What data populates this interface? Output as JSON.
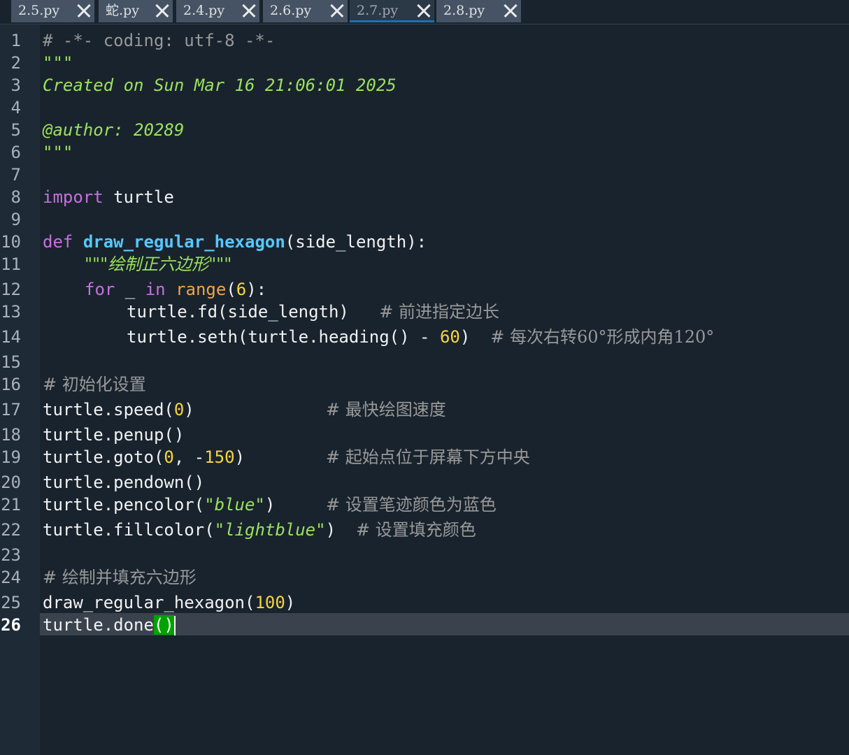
{
  "tabs": [
    {
      "label": "2.5.py",
      "active": false
    },
    {
      "label": "蛇.py",
      "active": false
    },
    {
      "label": "2.4.py",
      "active": false
    },
    {
      "label": "2.6.py",
      "active": false
    },
    {
      "label": "2.7.py",
      "active": true
    },
    {
      "label": "2.8.py",
      "active": false
    }
  ],
  "editor": {
    "current_line": 26,
    "line_numbers": [
      "1",
      "2",
      "3",
      "4",
      "5",
      "6",
      "7",
      "8",
      "9",
      "10",
      "11",
      "12",
      "13",
      "14",
      "15",
      "16",
      "17",
      "18",
      "19",
      "20",
      "21",
      "22",
      "23",
      "24",
      "25",
      "26"
    ],
    "code": {
      "l1": "# -*- coding: utf-8 -*-",
      "l2": "\"\"\"",
      "l3": "Created on Sun Mar 16 21:06:01 2025",
      "l5": "@author: 20289",
      "l6": "\"\"\"",
      "l8_kw": "import",
      "l8_rest": " turtle",
      "l10_kw": "def",
      "l10_fn": "draw_regular_hexagon",
      "l10_rest": "(side_length):",
      "l11": "\"\"\"绘制正六边形\"\"\"",
      "l12_for": "for",
      "l12_mid": " _ ",
      "l12_in": "in",
      "l12_range": "range",
      "l12_open": "(",
      "l12_num": "6",
      "l12_close": "):",
      "l13_code": "turtle.fd(side_length)",
      "l13_com": "# 前进指定边长",
      "l14_code": "turtle.seth(turtle.heading() - ",
      "l14_num": "60",
      "l14_close": ")",
      "l14_com": "# 每次右转60°形成内角120°",
      "l16_com": "# 初始化设置",
      "l17_a": "turtle.speed(",
      "l17_num": "0",
      "l17_b": ")",
      "l17_com": "# 最快绘图速度",
      "l18": "turtle.penup()",
      "l19_a": "turtle.goto(",
      "l19_num1": "0",
      "l19_b": ", -",
      "l19_num2": "150",
      "l19_c": ")",
      "l19_com": "# 起始点位于屏幕下方中央",
      "l20": "turtle.pendown()",
      "l21_a": "turtle.pencolor(",
      "l21_str": "\"blue\"",
      "l21_b": ")",
      "l21_com": "# 设置笔迹颜色为蓝色",
      "l22_a": "turtle.fillcolor(",
      "l22_str": "\"lightblue\"",
      "l22_b": ")",
      "l22_com": "# 设置填充颜色",
      "l24_com": "# 绘制并填充六边形",
      "l25_a": "draw_regular_hexagon(",
      "l25_num": "100",
      "l25_b": ")",
      "l26_a": "turtle.done",
      "l26_paren": "()"
    }
  },
  "colors": {
    "background": "#19232d",
    "keyword": "#c670e0",
    "function": "#57c7ff",
    "builtin": "#f0a448",
    "number": "#f5d541",
    "string": "#9be25d",
    "comment": "#999999",
    "match_highlight": "#00a200"
  }
}
